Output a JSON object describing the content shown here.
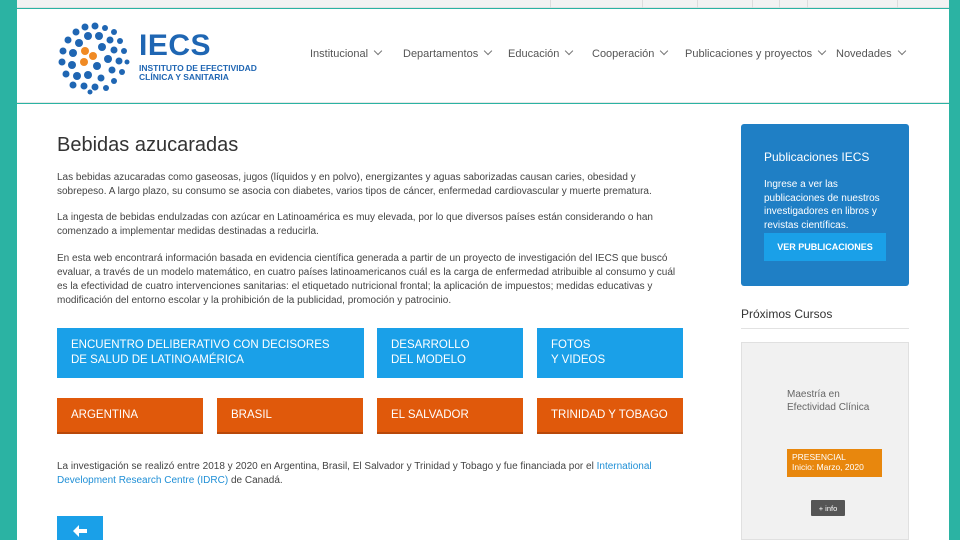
{
  "colors": {
    "background": "#2bb3a3",
    "brand_blue": "#1f66b3",
    "button_blue": "#1aa0e8",
    "button_orange": "#e0590b",
    "card_blue": "#1f7fc5",
    "badge_orange": "#e8870d",
    "link": "#1f8fd6"
  },
  "logo": {
    "name": "IECS",
    "line1": "INSTITUTO DE EFECTIVIDAD",
    "line2": "CLÍNICA Y SANITARIA"
  },
  "nav": [
    {
      "label": "Institucional",
      "icon": "chevron-down-icon"
    },
    {
      "label": "Departamentos",
      "icon": "chevron-down-icon"
    },
    {
      "label": "Educación",
      "icon": "chevron-down-icon"
    },
    {
      "label": "Cooperación",
      "icon": "chevron-down-icon"
    },
    {
      "label": "Publicaciones y proyectos",
      "icon": "chevron-down-icon"
    },
    {
      "label": "Novedades",
      "icon": "chevron-down-icon"
    }
  ],
  "main": {
    "title": "Bebidas azucaradas",
    "p1": "Las bebidas azucaradas como gaseosas, jugos (líquidos y en polvo), energizantes y aguas saborizadas causan caries, obesidad y sobrepeso. A largo plazo, su consumo se asocia con diabetes, varios tipos de cáncer, enfermedad cardiovascular y muerte prematura.",
    "p2": "La ingesta de bebidas endulzadas con azúcar en Latinoamérica es muy elevada, por lo que diversos países están considerando o han comenzado a implementar medidas destinadas a reducirla.",
    "p3": "En esta web encontrará información basada en evidencia científica generada a partir de un proyecto de investigación del IECS que buscó evaluar, a través de un modelo matemático, en cuatro países latinoamericanos cuál es la carga de enfermedad atribuible al consumo y cuál es la efectividad de cuatro intervenciones sanitarias: el etiquetado nutricional frontal; la aplicación de impuestos; medidas educativas y modificación del entorno escolar y la prohibición de la publicidad, promoción y patrocinio.",
    "buttons_blue": [
      {
        "line1": "Encuentro deliberativo con decisores",
        "line2": "de salud de Latinoamérica"
      },
      {
        "line1": "Desarrollo",
        "line2": "del modelo"
      },
      {
        "line1": "Fotos",
        "line2": "y videos"
      }
    ],
    "buttons_orange": [
      "Argentina",
      "Brasil",
      "El Salvador",
      "Trinidad y Tobago"
    ],
    "p4_before": "La investigación se realizó entre 2018 y 2020 en Argentina, Brasil, El Salvador y Trinidad y Tobago y fue financiada por el ",
    "p4_link": "International Development Research Centre (IDRC)",
    "p4_after": " de Canadá.",
    "back_icon": "arrow-left-icon"
  },
  "sidebar": {
    "pub_title": "Publicaciones IECS",
    "pub_desc": "Ingrese a ver las publicaciones de nuestros investigadores en libros y revistas científicas.",
    "pub_button": "VER PUBLICACIONES",
    "courses_title": "Próximos Cursos",
    "course_name": "Maestría en Efectividad Clínica",
    "course_mode": "PRESENCIAL",
    "course_start": "Inicio: Marzo, 2020",
    "course_more": "+ info"
  }
}
